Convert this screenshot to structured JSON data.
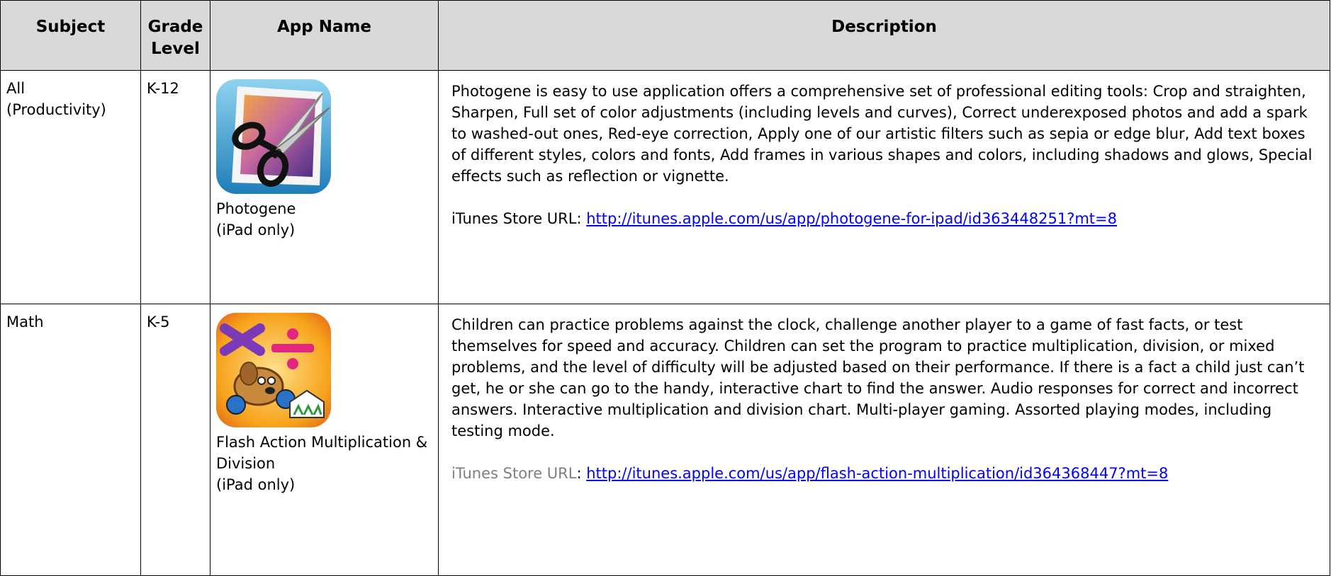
{
  "table": {
    "headers": [
      "Subject",
      "Grade Level",
      "App Name",
      "Description"
    ],
    "rows": [
      {
        "subject": "All\n(Productivity)",
        "grade": "K-12",
        "app_name": "Photogene\n(iPad only)",
        "icon": "photogene-scissors-icon",
        "description": "Photogene is easy to use application offers a comprehensive set of professional editing tools: Crop and straighten, Sharpen, Full set of color adjustments (including levels and curves), Correct underexposed photos and add a spark to washed-out ones, Red-eye correction, Apply one of our artistic filters such as sepia or edge blur,  Add text boxes of different styles, colors and fonts, Add frames in various shapes and colors, including shadows and glows, Special effects such as reflection or vignette.",
        "url_label": "iTunes Store URL: ",
        "url": "http://itunes.apple.com/us/app/photogene-for-ipad/id363448251?mt=8"
      },
      {
        "subject": "Math",
        "grade": "K-5",
        "app_name": "Flash Action Multiplication & Division\n(iPad only)",
        "icon": "flash-action-dog-icon",
        "description": "Children can practice problems against the clock, challenge another player to a game of fast facts, or test themselves for speed and accuracy. Children can set the program to practice multiplication, division, or mixed problems, and the level of difficulty will be adjusted based on their performance. If there is a fact a child just can’t get, he or she can go to the handy, interactive chart to find the answer. Audio responses for correct and incorrect answers. Interactive multiplication and division chart. Multi-player gaming. Assorted playing modes, including testing mode.",
        "url_label": "iTunes Store URL",
        "url_sep": ": ",
        "url": "http://itunes.apple.com/us/app/flash-action-multiplication/id364368447?mt=8"
      }
    ]
  },
  "colors": {
    "header_bg": "#d9d9d9",
    "link": "#0000ff",
    "grey_label": "#7f7f7f",
    "border": "#000000"
  }
}
